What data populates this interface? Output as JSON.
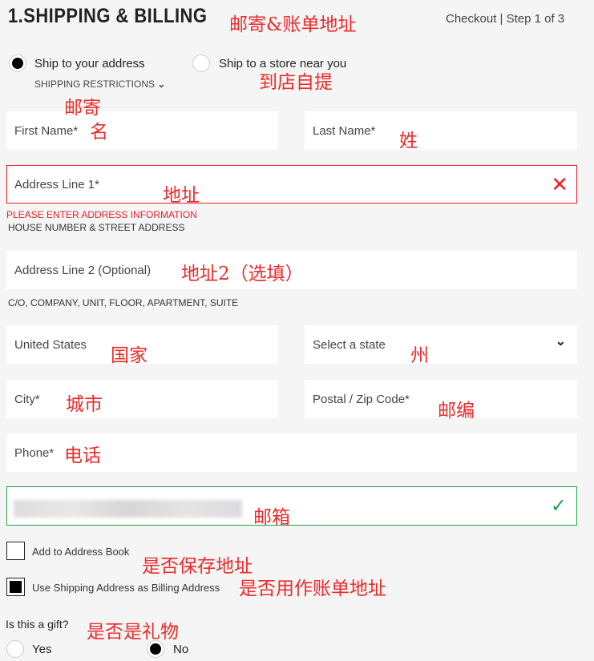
{
  "header": {
    "title": "1.SHIPPING & BILLING",
    "step": "Checkout | Step 1 of 3"
  },
  "shipping_options": [
    {
      "label": "Ship to your address",
      "selected": true
    },
    {
      "label": "Ship to a store near you",
      "selected": false
    }
  ],
  "shipping_restrictions": "SHIPPING RESTRICTIONS",
  "fields": {
    "first_name": "First Name*",
    "last_name": "Last Name*",
    "address1": "Address Line 1*",
    "address1_error": "PLEASE ENTER ADDRESS INFORMATION",
    "address1_help": "HOUSE NUMBER & STREET ADDRESS",
    "address2": "Address Line 2 (Optional)",
    "address2_help": "C/O, COMPANY, UNIT, FLOOR, APARTMENT, SUITE",
    "country": "United States",
    "state": "Select a state",
    "city": "City*",
    "postal": "Postal / Zip Code*",
    "phone": "Phone*"
  },
  "checkboxes": [
    {
      "label": "Add to Address Book",
      "checked": false
    },
    {
      "label": "Use Shipping Address as Billing Address",
      "checked": true
    }
  ],
  "gift": {
    "question": "Is this a gift?",
    "options": [
      {
        "label": "Yes",
        "selected": false
      },
      {
        "label": "No",
        "selected": true
      }
    ]
  },
  "annotations": {
    "title": "邮寄&账单地址",
    "store": "到店自提",
    "mail": "邮寄",
    "first": "名",
    "last": "姓",
    "addr": "地址",
    "addr2": "地址2（选填）",
    "country": "国家",
    "state": "州",
    "city": "城市",
    "postal": "邮编",
    "phone": "电话",
    "email": "邮箱",
    "save": "是否保存地址",
    "billing": "是否用作账单地址",
    "gift": "是否是礼物"
  },
  "colors": {
    "error": "#e8202a",
    "valid": "#1aa64a",
    "annotation": "#ee2a2a"
  }
}
